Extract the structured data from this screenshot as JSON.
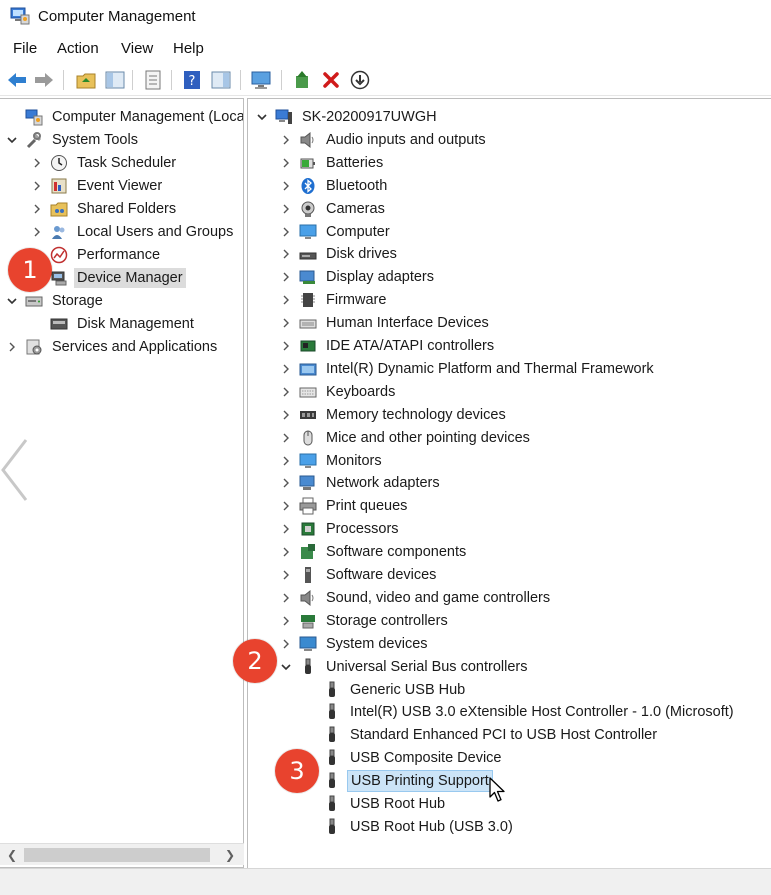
{
  "window": {
    "title": "Computer Management"
  },
  "menu": [
    "File",
    "Action",
    "View",
    "Help"
  ],
  "toolbar": [
    "back-icon",
    "forward-icon",
    "up-folder-icon",
    "show-hide-tree-icon",
    "properties-icon",
    "help-icon",
    "action-pane-icon",
    "computer-icon",
    "update-driver-icon",
    "uninstall-icon",
    "scan-hardware-icon"
  ],
  "left_tree": [
    {
      "label": "Computer Management (Local",
      "icon": "computer-management-icon",
      "chev": "none",
      "level": 0
    },
    {
      "label": "System Tools",
      "icon": "tools-icon",
      "chev": "down",
      "level": 1
    },
    {
      "label": "Task Scheduler",
      "icon": "clock-icon",
      "chev": "right",
      "level": 2
    },
    {
      "label": "Event Viewer",
      "icon": "event-viewer-icon",
      "chev": "right",
      "level": 2
    },
    {
      "label": "Shared Folders",
      "icon": "shared-folder-icon",
      "chev": "right",
      "level": 2
    },
    {
      "label": "Local Users and Groups",
      "icon": "users-icon",
      "chev": "right",
      "level": 2
    },
    {
      "label": "Performance",
      "icon": "performance-icon",
      "chev": "right",
      "level": 2
    },
    {
      "label": "Device Manager",
      "icon": "device-manager-icon",
      "chev": "none",
      "level": 2,
      "selected": true
    },
    {
      "label": "Storage",
      "icon": "storage-icon",
      "chev": "down",
      "level": 1
    },
    {
      "label": "Disk Management",
      "icon": "disk-management-icon",
      "chev": "none",
      "level": 2
    },
    {
      "label": "Services and Applications",
      "icon": "services-icon",
      "chev": "right",
      "level": 1
    }
  ],
  "device_tree": {
    "root": "SK-20200917UWGH",
    "categories": [
      {
        "label": "Audio inputs and outputs",
        "icon": "speaker-icon"
      },
      {
        "label": "Batteries",
        "icon": "battery-icon"
      },
      {
        "label": "Bluetooth",
        "icon": "bluetooth-icon"
      },
      {
        "label": "Cameras",
        "icon": "camera-icon"
      },
      {
        "label": "Computer",
        "icon": "monitor-icon"
      },
      {
        "label": "Disk drives",
        "icon": "disk-drive-icon"
      },
      {
        "label": "Display adapters",
        "icon": "display-adapter-icon"
      },
      {
        "label": "Firmware",
        "icon": "firmware-icon"
      },
      {
        "label": "Human Interface Devices",
        "icon": "hid-icon"
      },
      {
        "label": "IDE ATA/ATAPI controllers",
        "icon": "ide-controller-icon"
      },
      {
        "label": "Intel(R) Dynamic Platform and Thermal Framework",
        "icon": "intel-framework-icon"
      },
      {
        "label": "Keyboards",
        "icon": "keyboard-icon"
      },
      {
        "label": "Memory technology devices",
        "icon": "memory-icon"
      },
      {
        "label": "Mice and other pointing devices",
        "icon": "mouse-icon"
      },
      {
        "label": "Monitors",
        "icon": "monitor-icon"
      },
      {
        "label": "Network adapters",
        "icon": "network-adapter-icon"
      },
      {
        "label": "Print queues",
        "icon": "printer-icon"
      },
      {
        "label": "Processors",
        "icon": "processor-icon"
      },
      {
        "label": "Software components",
        "icon": "software-component-icon"
      },
      {
        "label": "Software devices",
        "icon": "software-device-icon"
      },
      {
        "label": "Sound, video and game controllers",
        "icon": "speaker-icon"
      },
      {
        "label": "Storage controllers",
        "icon": "storage-controller-icon"
      },
      {
        "label": "System devices",
        "icon": "system-device-icon"
      },
      {
        "label": "Universal Serial Bus controllers",
        "icon": "usb-icon",
        "expanded": true
      }
    ],
    "usb_children": [
      "Generic USB Hub",
      "Intel(R) USB 3.0 eXtensible Host Controller - 1.0 (Microsoft)",
      "Standard Enhanced PCI to USB Host Controller",
      "USB Composite Device",
      "USB Printing Support",
      "USB Root Hub",
      "USB Root Hub (USB 3.0)"
    ],
    "hovered": "USB Printing Support"
  },
  "badges": [
    "1",
    "2",
    "3"
  ],
  "colors": {
    "badge": "#e8432e",
    "selection": "#dcdcdc",
    "hover": "#cce4f7"
  }
}
